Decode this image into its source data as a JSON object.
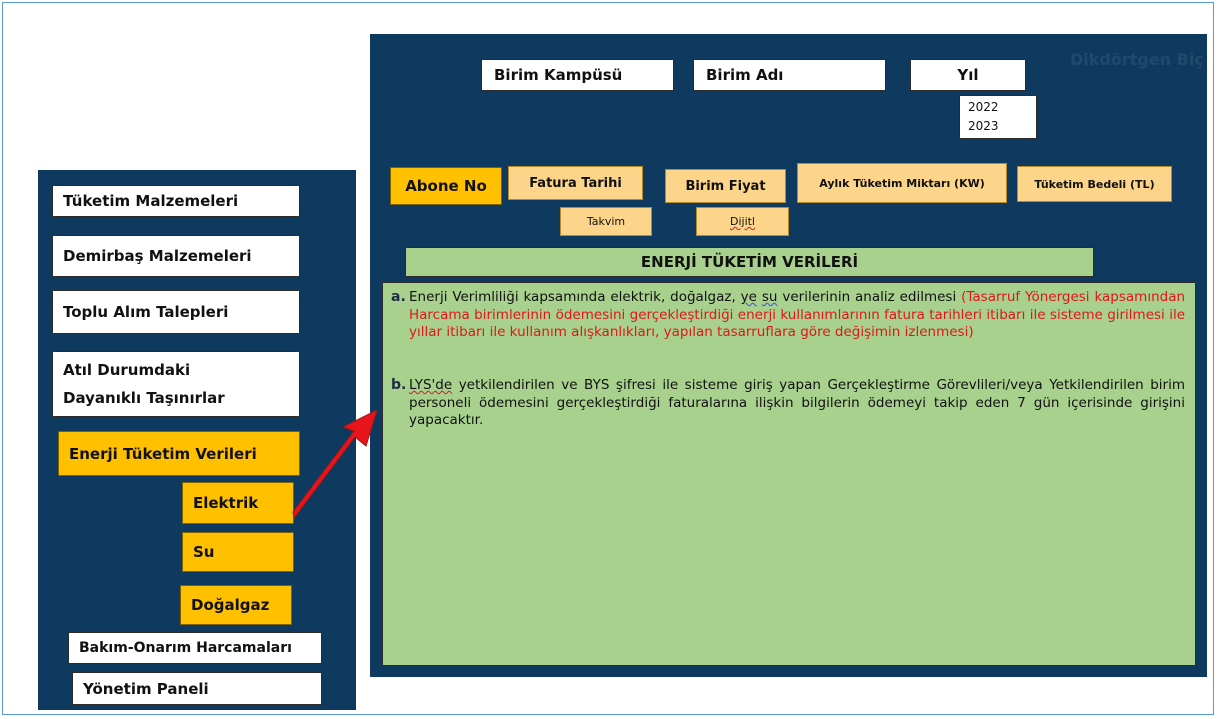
{
  "sidebar": {
    "items": [
      {
        "label": "Tüketim Malzemeleri"
      },
      {
        "label": "Demirbaş Malzemeleri"
      },
      {
        "label": "Toplu Alım Talepleri"
      },
      {
        "label_line1": "Atıl Durumdaki",
        "label_line2": "Dayanıklı Taşınırlar"
      },
      {
        "label": "Enerji Tüketim Verileri"
      },
      {
        "label": "Elektrik"
      },
      {
        "label": "Su"
      },
      {
        "label": "Doğalgaz"
      },
      {
        "label": "Bakım-Onarım Harcamaları"
      },
      {
        "label": "Yönetim Paneli"
      }
    ]
  },
  "form": {
    "ghost_text": "Dikdörtgen Biç",
    "campus_label": "Birim Kampüsü",
    "unit_label": "Birim Adı",
    "year_label": "Yıl",
    "year_options": [
      "2022",
      "2023"
    ],
    "subscriber_label": "Abone No",
    "invoice_date_label": "Fatura Tarihi",
    "unit_price_label": "Birim Fiyat",
    "monthly_consumption_label": "Aylık Tüketim Miktarı (KW)",
    "consumption_cost_label": "Tüketim Bedeli (TL)",
    "calendar_label": "Takvim",
    "digital_label": "Dijitl"
  },
  "section": {
    "title": "ENERJİ TÜKETİM VERİLERİ",
    "notes": [
      {
        "marker": "a.",
        "p1": "Enerji Verimliliği kapsamında elektrik, doğalgaz,",
        "p2": "ye",
        "p3": "su",
        "p4": "verilerinin analiz edilmesi",
        "red": "(Tasarruf Yönergesi kapsamından Harcama birimlerinin ödemesini gerçekleştirdiği enerji kullanımlarının fatura tarihleri itibarı ile sisteme girilmesi ile yıllar itibarı ile kullanım alışkanlıkları, yapılan tasarruflara göre değişimin izlenmesi)"
      },
      {
        "marker": "b.",
        "p1": "LYS'de",
        "p2": "yetkilendirilen ve BYS şifresi ile sisteme giriş yapan Gerçekleştirme Görevlileri/veya Yetkilendirilen birim personeli ödemesini gerçekleştirdiği faturalarına ilişkin bilgilerin ödemeyi takip eden 7 gün içerisinde girişini yapacaktır."
      }
    ]
  },
  "colors": {
    "panel": "#0f3a60",
    "accent_orange": "#ffc000",
    "light_orange": "#fdd58a",
    "green": "#a9d18e",
    "arrow_red": "#e8141b",
    "note_red": "#e0161b"
  },
  "icons": {
    "arrow": "red-diagonal-arrow"
  }
}
